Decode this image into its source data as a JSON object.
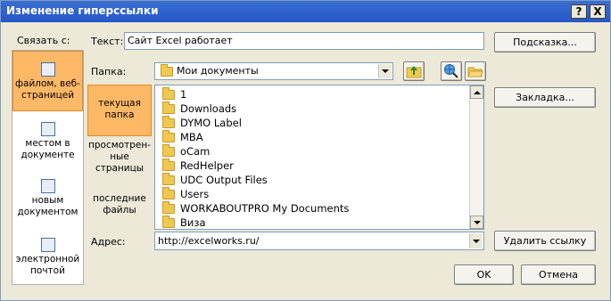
{
  "window": {
    "title": "Изменение гиперссылки",
    "help_label": "?",
    "close_label": "X"
  },
  "link_with": {
    "label": "Связать с:",
    "items": [
      {
        "label": "файлом, веб-страницей",
        "line1": "файлом, веб-",
        "line2": "страницей",
        "icon": "web-page-icon",
        "selected": true
      },
      {
        "label": "местом в документе",
        "line1": "местом в",
        "line2": "документе",
        "icon": "place-in-document-icon"
      },
      {
        "label": "новым документом",
        "line1": "новым",
        "line2": "документом",
        "icon": "new-document-icon"
      },
      {
        "label": "электронной почтой",
        "line1": "электронной",
        "line2": "почтой",
        "icon": "email-icon"
      }
    ]
  },
  "text_field": {
    "label": "Текст:",
    "value": "Сайт Excel работает"
  },
  "screentip_button": "Подсказка...",
  "folder": {
    "label": "Папка:",
    "value": "Мои документы"
  },
  "places": [
    {
      "line1": "текущая",
      "line2": "папка",
      "line3": "",
      "selected": true
    },
    {
      "line1": "просмотрен-",
      "line2": "ные",
      "line3": "страницы"
    },
    {
      "line1": "последние",
      "line2": "файлы",
      "line3": ""
    }
  ],
  "files": [
    "1",
    "Downloads",
    "DYMO Label",
    "MBA",
    "oCam",
    "RedHelper",
    "UDC Output Files",
    "Users",
    "WORKABOUTPRO My Documents",
    "Виза"
  ],
  "bookmark_button": "Закладка...",
  "address": {
    "label": "Адрес:",
    "value": "http://excelworks.ru/"
  },
  "remove_link_button": "Удалить ссылку",
  "ok_button": "OK",
  "cancel_button": "Отмена",
  "colors": {
    "title_bar": "#2657c7",
    "selected_item": "#ffb866",
    "dialog_bg": "#ece9d8"
  }
}
